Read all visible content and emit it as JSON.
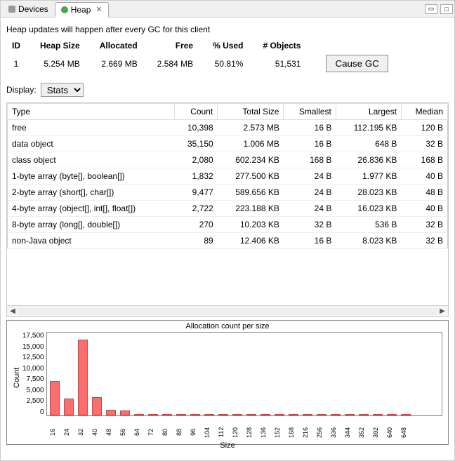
{
  "tabs": [
    {
      "label": "Devices",
      "active": false
    },
    {
      "label": "Heap",
      "active": true
    }
  ],
  "info_text": "Heap updates will happen after every GC for this client",
  "heap_summary": {
    "headers": [
      "ID",
      "Heap Size",
      "Allocated",
      "Free",
      "% Used",
      "# Objects"
    ],
    "row": [
      "1",
      "5.254 MB",
      "2.669 MB",
      "2.584 MB",
      "50.81%",
      "51,531"
    ],
    "button": "Cause GC"
  },
  "display": {
    "label": "Display:",
    "value": "Stats"
  },
  "type_table": {
    "headers": [
      "Type",
      "Count",
      "Total Size",
      "Smallest",
      "Largest",
      "Median"
    ],
    "rows": [
      [
        "free",
        "10,398",
        "2.573 MB",
        "16 B",
        "112.195 KB",
        "120 B"
      ],
      [
        "data object",
        "35,150",
        "1.006 MB",
        "16 B",
        "648 B",
        "32 B"
      ],
      [
        "class object",
        "2,080",
        "602.234 KB",
        "168 B",
        "26.836 KB",
        "168 B"
      ],
      [
        "1-byte array (byte[], boolean[])",
        "1,832",
        "277.500 KB",
        "24 B",
        "1.977 KB",
        "40 B"
      ],
      [
        "2-byte array (short[], char[])",
        "9,477",
        "589.656 KB",
        "24 B",
        "28.023 KB",
        "48 B"
      ],
      [
        "4-byte array (object[], int[], float[])",
        "2,722",
        "223.188 KB",
        "24 B",
        "16.023 KB",
        "40 B"
      ],
      [
        "8-byte array (long[], double[])",
        "270",
        "10.203 KB",
        "32 B",
        "536 B",
        "32 B"
      ],
      [
        "non-Java object",
        "89",
        "12.406 KB",
        "16 B",
        "8.023 KB",
        "32 B"
      ]
    ]
  },
  "chart_data": {
    "type": "bar",
    "title": "Allocation count per size",
    "xlabel": "Size",
    "ylabel": "Count",
    "ylim": [
      0,
      17500
    ],
    "yticks": [
      "17,500",
      "15,000",
      "12,500",
      "10,000",
      "7,500",
      "5,000",
      "2,500",
      "0"
    ],
    "categories": [
      "16",
      "24",
      "32",
      "40",
      "48",
      "56",
      "64",
      "72",
      "80",
      "88",
      "96",
      "104",
      "112",
      "120",
      "128",
      "136",
      "152",
      "168",
      "216",
      "256",
      "336",
      "344",
      "352",
      "392",
      "640",
      "648"
    ],
    "values": [
      7200,
      3500,
      16000,
      3800,
      1200,
      1000,
      300,
      200,
      150,
      120,
      100,
      90,
      80,
      70,
      60,
      50,
      40,
      30,
      25,
      20,
      18,
      15,
      12,
      10,
      8,
      6
    ]
  }
}
